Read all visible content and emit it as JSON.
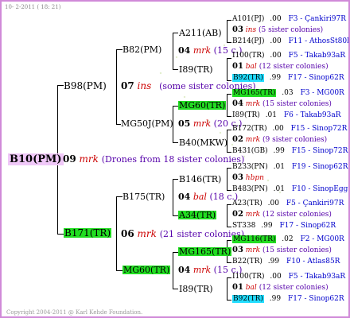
{
  "header": "10-  2-2011 ( 18: 21)",
  "footer": "Copyright 2004-2011 @ Karl Kehde Foundation.",
  "root": {
    "label": "B10(PM)",
    "gen": "09",
    "code": "mrk",
    "note": "(Drones from 18 sister colonies)"
  },
  "mother_a": {
    "label": "B98(PM)",
    "gen": "07",
    "code": "ins",
    "note": "(some sister colonies)"
  },
  "mother_b": {
    "label": "B171(TR)",
    "gen": "06",
    "code": "mrk",
    "note": "(21 sister colonies)"
  },
  "gm": [
    {
      "label": "B82(PM)",
      "gen": "04",
      "code": "mrk",
      "note": "(15 c.)"
    },
    {
      "label": "MG50J(PM)",
      "gen": "05",
      "code": "mrk",
      "note": "(20 c.)"
    },
    {
      "label": "B175(TR)",
      "gen": "04",
      "code": "bal",
      "note": "(18 c.)"
    },
    {
      "label": "MG60(TR)",
      "gen": "04",
      "code": "mrk",
      "note": "(15 c.)"
    }
  ],
  "ggm": [
    {
      "top": "A211(AB)",
      "bottom": "I89(TR)"
    },
    {
      "top": "MG60(TR)",
      "bottom": "B40(MKW)"
    },
    {
      "top": "B146(TR)",
      "bottom": "A34(TR)"
    },
    {
      "top": "MG165(TR)",
      "bottom": "I89(TR)"
    }
  ],
  "leaves": [
    {
      "top": {
        "name": "A101(PJ)",
        "val": ".00",
        "info": "F3 - Çankiri97R"
      },
      "gen": "03",
      "code": "ins",
      "note": "(5 sister colonies)",
      "bottom": {
        "name": "B214(PJ)",
        "val": ".00",
        "info": "F11 - AthosSt80R"
      }
    },
    {
      "top": {
        "name": "I100(TR)",
        "val": ".00",
        "info": "F5 - Takab93aR"
      },
      "gen": "01",
      "code": "bal",
      "note": "(12 sister colonies)",
      "bottom": {
        "name": "B92(TR)",
        "val": ".99",
        "info": "F17 - Sinop62R"
      }
    },
    {
      "top": {
        "name": "MG165(TR)",
        "val": ".03",
        "info": "F3 - MG00R"
      },
      "gen": "04",
      "code": "mrk",
      "note": "(15 sister colonies)",
      "bottom": {
        "name": "I89(TR)",
        "val": ".01",
        "info": "F6 - Takab93aR"
      }
    },
    {
      "top": {
        "name": "B172(TR)",
        "val": ".00",
        "info": "F15 - Sinop72R"
      },
      "gen": "02",
      "code": "mrk",
      "note": "(9 sister colonies)",
      "bottom": {
        "name": "B431(GB)",
        "val": ".99",
        "info": "F15 - Sinop72R"
      }
    },
    {
      "top": {
        "name": "B233(PN)",
        "val": ".01",
        "info": "F19 - Sinop62R"
      },
      "gen": "03",
      "code": "hbpn",
      "note": "",
      "bottom": {
        "name": "B483(PN)",
        "val": ".01",
        "info": "F10 - SinopEgg86R"
      }
    },
    {
      "top": {
        "name": "A23(TR)",
        "val": ".00",
        "info": "F5 - Çankiri97R"
      },
      "gen": "02",
      "code": "mrk",
      "note": "(12 sister colonies)",
      "bottom": {
        "name": "ST338",
        "val": ".99",
        "info": "F17 - Sinop62R"
      }
    },
    {
      "top": {
        "name": "MG116(TR)",
        "val": ".02",
        "info": "F2 - MG00R"
      },
      "gen": "03",
      "code": "mrk",
      "note": "(15 sister colonies)",
      "bottom": {
        "name": "B22(TR)",
        "val": ".99",
        "info": "F10 - Atlas85R"
      }
    },
    {
      "top": {
        "name": "I100(TR)",
        "val": ".00",
        "info": "F5 - Takab93aR"
      },
      "gen": "01",
      "code": "bal",
      "note": "(12 sister colonies)",
      "bottom": {
        "name": "B92(TR)",
        "val": ".99",
        "info": "F17 - Sinop62R"
      }
    }
  ],
  "colors": {
    "frame": "#d08ad8",
    "highlight_green": "#22dd22",
    "highlight_cyan": "#22ddff",
    "root_bg": "#f0c8f8",
    "code_red": "#cc0000",
    "note_purple": "#5500aa",
    "info_blue": "#0000cc"
  }
}
